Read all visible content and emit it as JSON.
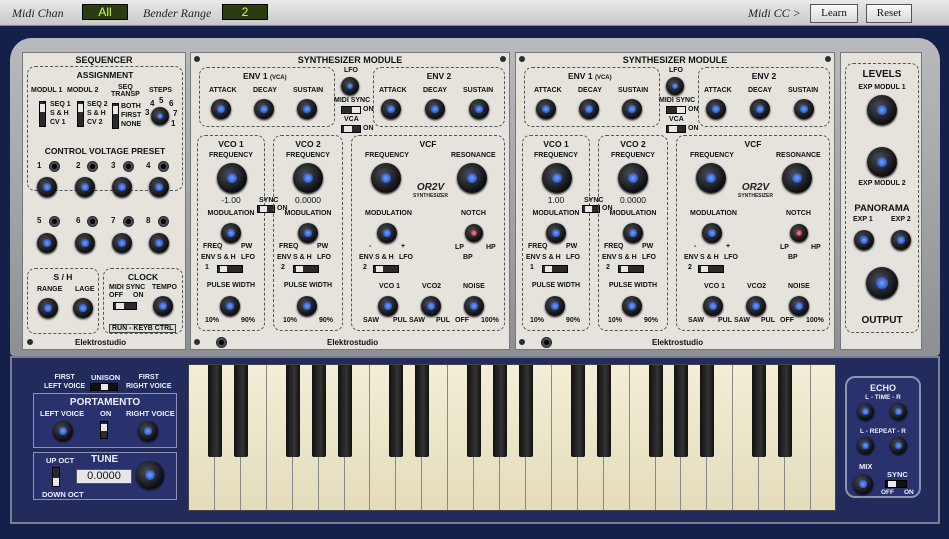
{
  "topbar": {
    "midi_chan_label": "Midi Chan",
    "midi_chan_value": "All",
    "bender_label": "Bender Range",
    "bender_value": "2",
    "midi_cc_label": "Midi CC >",
    "learn_label": "Learn",
    "reset_label": "Reset"
  },
  "sequencer": {
    "title": "SEQUENCER",
    "assignment": "ASSIGNMENT",
    "modul1": "MODUL 1",
    "modul2": "MODUL 2",
    "seq_transp": "SEQ\nTRANSP",
    "steps": "STEPS",
    "seq1": "SEQ 1",
    "sh": "S & H",
    "cv1": "CV 1",
    "seq2": "SEQ 2",
    "sh2": "S & H",
    "cv2": "CV 2",
    "both": "BOTH",
    "first": "FIRST",
    "none": "NONE",
    "steps_nums": [
      "3",
      "4",
      "5",
      "6",
      "7",
      "1"
    ],
    "cv_preset": "CONTROL VOLTAGE PRESET",
    "preset_nums": [
      "1",
      "2",
      "3",
      "4",
      "5",
      "6",
      "7",
      "8"
    ],
    "sh_title": "S / H",
    "range": "RANGE",
    "lage": "LAGE",
    "clock": "CLOCK",
    "midi_sync": "MIDI SYNC",
    "off": "OFF",
    "on": "ON",
    "tempo": "TEMPO",
    "run_keyb": "RUN - KEYB CTRL",
    "brand": "Elektrostudio"
  },
  "modules": [
    {
      "title": "SYNTHESIZER MODULE",
      "env1": "ENV 1",
      "vca_tag": "(VCA)",
      "env2": "ENV 2",
      "attack": "ATTACK",
      "decay": "DECAY",
      "sustain": "SUSTAIN",
      "lfo": "LFO",
      "midi_sync": "MIDI SYNC",
      "on": "ON",
      "vca": "VCA",
      "vco1": "VCO 1",
      "vco2": "VCO 2",
      "vcf": "VCF",
      "frequency": "FREQUENCY",
      "resonance": "RESONANCE",
      "vco1_value": "-1.00",
      "vco2_value": "0.0000",
      "sync": "SYNC",
      "modulation": "MODULATION",
      "notch": "NOTCH",
      "freq": "FREQ",
      "pw": "PW",
      "env": "ENV",
      "sh": "S & H",
      "lfo2": "LFO",
      "one": "1",
      "two": "2",
      "minus": "-",
      "plus": "+",
      "lp": "LP",
      "hp": "HP",
      "bp": "BP",
      "pulse_width": "PULSE WIDTH",
      "pct10": "10%",
      "pct90": "90%",
      "saw": "SAW",
      "pul": "PUL",
      "noise": "NOISE",
      "off": "OFF",
      "pct100": "100%",
      "vco2small": "VCO2",
      "logo": "OR2V",
      "logo_sub": "SYNTHESIZER",
      "brand": "Elektrostudio"
    },
    {
      "title": "SYNTHESIZER MODULE",
      "env1": "ENV 1",
      "vca_tag": "(VCA)",
      "env2": "ENV 2",
      "attack": "ATTACK",
      "decay": "DECAY",
      "sustain": "SUSTAIN",
      "lfo": "LFO",
      "midi_sync": "MIDI SYNC",
      "on": "ON",
      "vca": "VCA",
      "vco1": "VCO 1",
      "vco2": "VCO 2",
      "vcf": "VCF",
      "frequency": "FREQUENCY",
      "resonance": "RESONANCE",
      "vco1_value": "1.00",
      "vco2_value": "0.0000",
      "sync": "SYNC",
      "modulation": "MODULATION",
      "notch": "NOTCH",
      "freq": "FREQ",
      "pw": "PW",
      "env": "ENV",
      "sh": "S & H",
      "lfo2": "LFO",
      "one": "1",
      "two": "2",
      "minus": "-",
      "plus": "+",
      "lp": "LP",
      "hp": "HP",
      "bp": "BP",
      "pulse_width": "PULSE WIDTH",
      "pct10": "10%",
      "pct90": "90%",
      "saw": "SAW",
      "pul": "PUL",
      "noise": "NOISE",
      "off": "OFF",
      "pct100": "100%",
      "vco2small": "VCO2",
      "logo": "OR2V",
      "logo_sub": "SYNTHESIZER",
      "brand": "Elektrostudio"
    }
  ],
  "levels": {
    "title": "LEVELS",
    "exp_modul1": "EXP MODUL 1",
    "exp_modul2": "EXP MODUL 2",
    "panorama": "PANORAMA",
    "exp1": "EXP 1",
    "exp2": "EXP 2",
    "output": "OUTPUT"
  },
  "bottom_left": {
    "first_left": "FIRST\nLEFT VOICE",
    "unison": "UNISON",
    "first_right": "FIRST\nRIGHT VOICE",
    "portamento": "PORTAMENTO",
    "left_voice": "LEFT VOICE",
    "on": "ON",
    "right_voice": "RIGHT VOICE",
    "up_oct": "UP OCT",
    "tune": "TUNE",
    "tune_value": "0.0000",
    "down_oct": "DOWN OCT"
  },
  "echo": {
    "title": "ECHO",
    "time": "L - TIME - R",
    "repeat": "L - REPEAT - R",
    "mix": "MIX",
    "sync": "SYNC",
    "off": "OFF",
    "on": "ON"
  },
  "colors": {
    "panel": "#e6e3dc",
    "knob_cap": "#1f5cff",
    "lcd_text": "#c8ff57",
    "frame": "#232a5c"
  }
}
